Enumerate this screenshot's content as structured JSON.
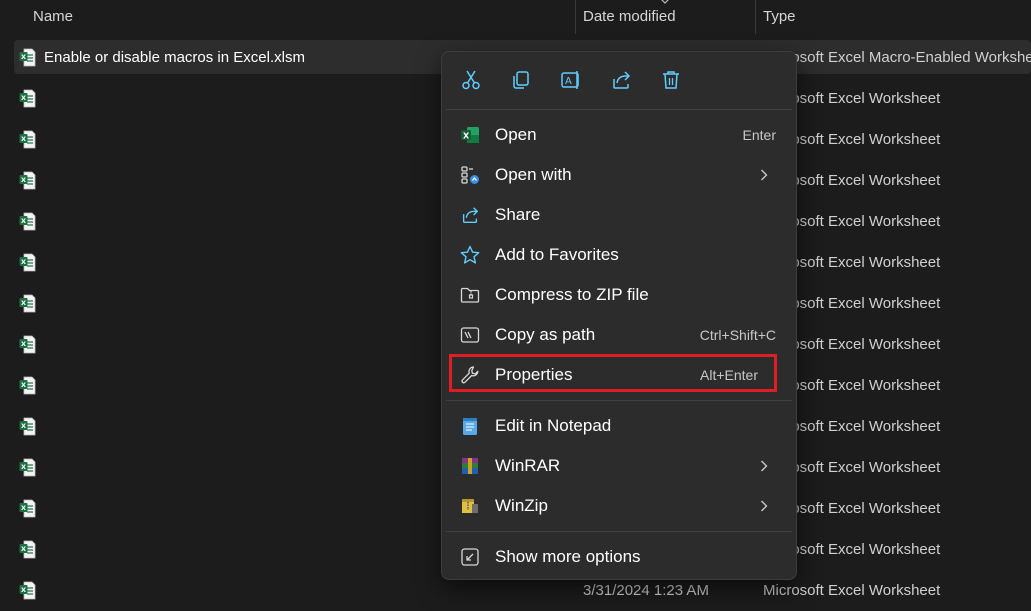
{
  "header": {
    "name_label": "Name",
    "date_label": "Date modified",
    "type_label": "Type"
  },
  "files": [
    {
      "name": "Enable or disable macros in Excel.xlsm",
      "date": "",
      "type": "Microsoft Excel Macro-Enabled Worksheet",
      "selected": true
    },
    {
      "name": "",
      "date": "",
      "type": "Microsoft Excel Worksheet"
    },
    {
      "name": "",
      "date": "",
      "type": "Microsoft Excel Worksheet"
    },
    {
      "name": "",
      "date": "",
      "type": "Microsoft Excel Worksheet"
    },
    {
      "name": "",
      "date": "",
      "type": "Microsoft Excel Worksheet"
    },
    {
      "name": "",
      "date": "",
      "type": "Microsoft Excel Worksheet"
    },
    {
      "name": "",
      "date": "",
      "type": "Microsoft Excel Worksheet"
    },
    {
      "name": "",
      "date": "",
      "type": "Microsoft Excel Worksheet"
    },
    {
      "name": "",
      "date": "",
      "type": "Microsoft Excel Worksheet"
    },
    {
      "name": "",
      "date": "",
      "type": "Microsoft Excel Worksheet"
    },
    {
      "name": "",
      "date": "",
      "type": "Microsoft Excel Worksheet"
    },
    {
      "name": "",
      "date": "",
      "type": "Microsoft Excel Worksheet"
    },
    {
      "name": "",
      "date": "",
      "type": "Microsoft Excel Worksheet"
    },
    {
      "name": "",
      "date": "3/31/2024 1:23 AM",
      "type": "Microsoft Excel Worksheet"
    }
  ],
  "quick_actions": [
    {
      "name": "cut-icon"
    },
    {
      "name": "copy-icon"
    },
    {
      "name": "rename-icon"
    },
    {
      "name": "share-icon"
    },
    {
      "name": "delete-icon"
    }
  ],
  "menu": {
    "items": [
      {
        "label": "Open",
        "shortcut": "Enter",
        "icon": "excel-icon"
      },
      {
        "label": "Open with",
        "shortcut": "",
        "icon": "open-with-icon",
        "submenu": true
      },
      {
        "label": "Share",
        "shortcut": "",
        "icon": "share-icon"
      },
      {
        "label": "Add to Favorites",
        "shortcut": "",
        "icon": "star-icon"
      },
      {
        "label": "Compress to ZIP file",
        "shortcut": "",
        "icon": "zip-folder-icon"
      },
      {
        "label": "Copy as path",
        "shortcut": "Ctrl+Shift+C",
        "icon": "copy-path-icon"
      },
      {
        "label": "Properties",
        "shortcut": "Alt+Enter",
        "icon": "wrench-icon",
        "highlighted": true
      },
      {
        "label": "Edit in Notepad",
        "shortcut": "",
        "icon": "notepad-icon"
      },
      {
        "label": "WinRAR",
        "shortcut": "",
        "icon": "winrar-icon",
        "submenu": true
      },
      {
        "label": "WinZip",
        "shortcut": "",
        "icon": "winzip-icon",
        "submenu": true
      },
      {
        "label": "Show more options",
        "shortcut": "",
        "icon": "more-options-icon"
      }
    ]
  },
  "colors": {
    "background": "#1c1c1c",
    "menu_background": "#2c2c2c",
    "accent": "#60cdff",
    "highlight_box": "#e01c24",
    "excel_green": "#1d7044"
  }
}
